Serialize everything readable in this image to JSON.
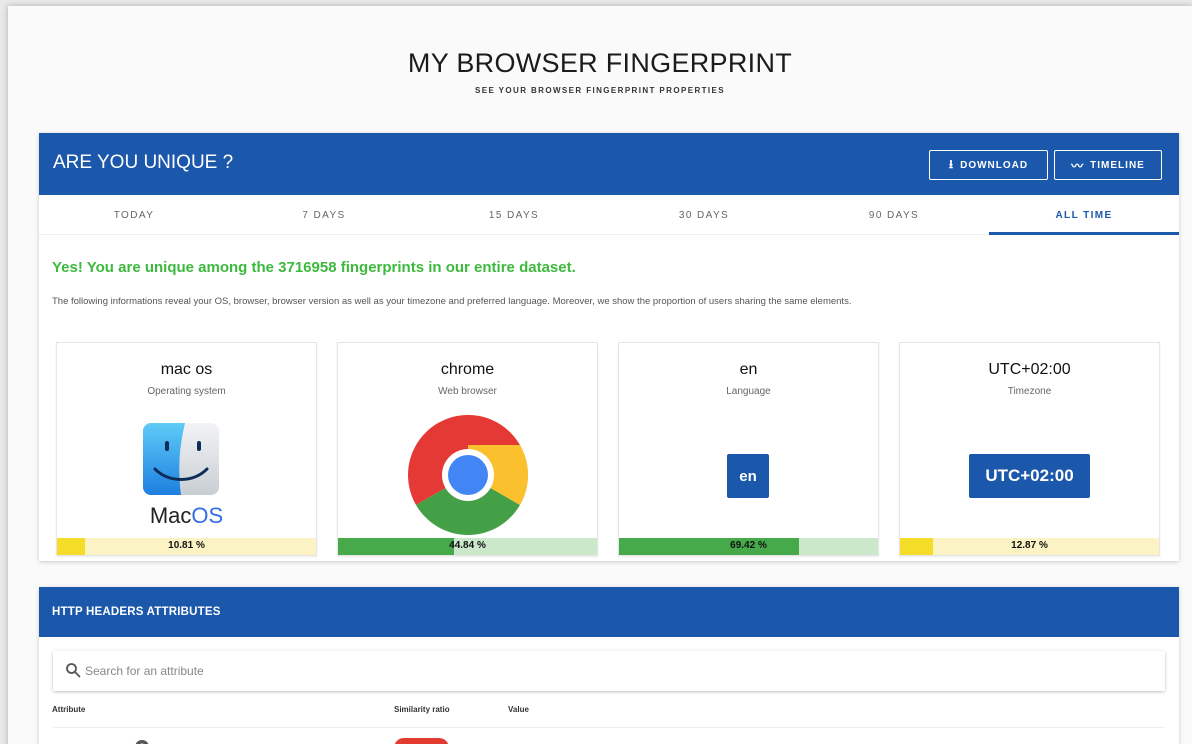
{
  "header": {
    "title": "MY BROWSER FINGERPRINT",
    "subtitle": "SEE YOUR BROWSER FINGERPRINT PROPERTIES"
  },
  "unique_card": {
    "title": "ARE YOU UNIQUE ?",
    "buttons": {
      "download": "DOWNLOAD",
      "timeline": "TIMELINE"
    },
    "tabs": [
      {
        "label": "TODAY",
        "active": false
      },
      {
        "label": "7 DAYS",
        "active": false
      },
      {
        "label": "15 DAYS",
        "active": false
      },
      {
        "label": "30 DAYS",
        "active": false
      },
      {
        "label": "90 DAYS",
        "active": false
      },
      {
        "label": "ALL TIME",
        "active": true
      }
    ],
    "message": "Yes! You are unique among the 3716958 fingerprints in our entire dataset.",
    "explanation": "The following informations reveal your OS, browser, browser version as well as your timezone and preferred language. Moreover, we show the proportion of users sharing the same elements.",
    "tiles": [
      {
        "value": "mac os",
        "label": "Operating system",
        "logo_text_a": "Mac",
        "logo_text_b": "OS",
        "percent": "10.81 %",
        "share": 0.1081,
        "bar_color": "yellow"
      },
      {
        "value": "chrome",
        "label": "Web browser",
        "percent": "44.84 %",
        "share": 0.4484,
        "bar_color": "green"
      },
      {
        "value": "en",
        "label": "Language",
        "badge": "en",
        "percent": "69.42 %",
        "share": 0.6942,
        "bar_color": "green"
      },
      {
        "value": "UTC+02:00",
        "label": "Timezone",
        "badge": "UTC+02:00",
        "percent": "12.87 %",
        "share": 0.1287,
        "bar_color": "yellow"
      }
    ]
  },
  "http_card": {
    "title": "HTTP HEADERS ATTRIBUTES",
    "search": {
      "placeholder": "Search for an attribute",
      "value": ""
    },
    "columns": [
      "Attribute",
      "Similarity ratio",
      "Value"
    ]
  },
  "colors": {
    "primary": "#1b57ab",
    "success_text": "#3db93d",
    "bar_yellow": "#f5dc28",
    "bar_green": "#46a94a"
  }
}
